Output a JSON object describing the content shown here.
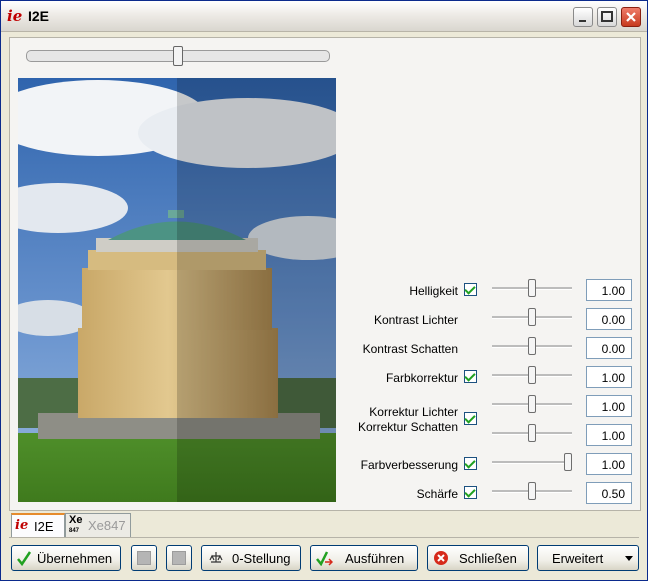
{
  "window": {
    "title": "I2E",
    "logo": "ie"
  },
  "controls": [
    {
      "label": "Helligkeit",
      "checked": true,
      "slider": 0.5,
      "value": "1.00"
    },
    {
      "label": "Kontrast Lichter",
      "checked": false,
      "slider": 0.5,
      "value": "0.00"
    },
    {
      "label": "Kontrast Schatten",
      "checked": false,
      "slider": 0.5,
      "value": "0.00"
    },
    {
      "label": "Farbkorrektur",
      "checked": true,
      "slider": 0.5,
      "value": "1.00"
    },
    {
      "label": "Korrektur Lichter",
      "checked": true,
      "slider": 0.5,
      "value": "1.00"
    },
    {
      "label": "Korrektur Schatten",
      "checked": true,
      "slider": 0.5,
      "value": "1.00"
    },
    {
      "label": "Farbverbesserung",
      "checked": true,
      "slider": 0.95,
      "value": "1.00"
    },
    {
      "label": "Schärfe",
      "checked": true,
      "slider": 0.5,
      "value": "0.50"
    }
  ],
  "preview": {
    "split_position": 0.5
  },
  "tabs": [
    {
      "label": "I2E",
      "icon": "ie-logo-icon"
    },
    {
      "label": "Xe847",
      "icon": "xe847-logo-icon",
      "icon_text": "Xe",
      "icon_sub": "847"
    }
  ],
  "toolbar": {
    "apply_label": "Übernehmen",
    "reset_label": "0-Stellung",
    "run_label": "Ausführen",
    "close_label": "Schließen",
    "advanced_label": "Erweitert"
  },
  "colors": {
    "check": "#21a121",
    "close_red": "#d62a1b",
    "tab_accent": "#e68b2c"
  }
}
